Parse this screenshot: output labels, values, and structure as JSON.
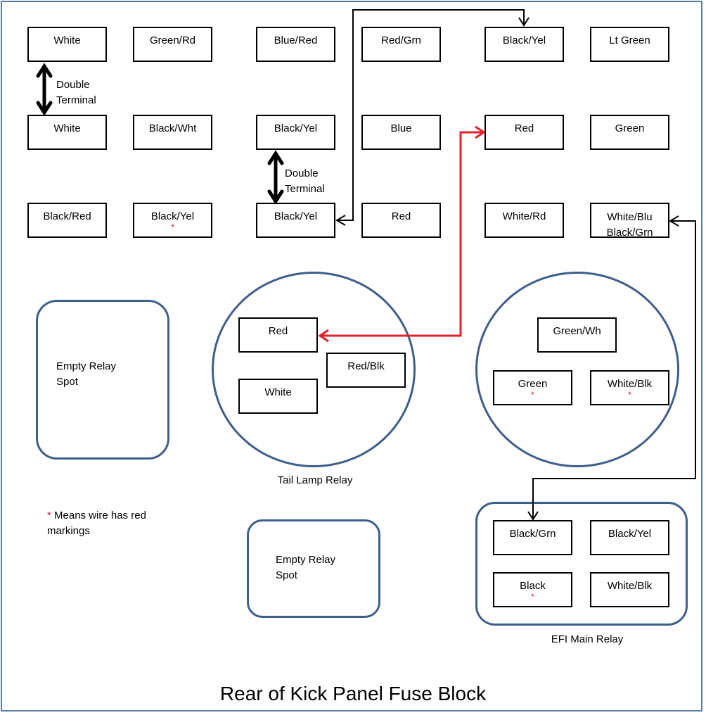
{
  "title": "Rear of Kick Panel Fuse Block",
  "legend": {
    "star": "*",
    "text": "Means wire has red markings"
  },
  "fuse_rows": [
    [
      "White",
      "Green/Rd",
      "Blue/Red",
      "Red/Grn",
      "Black/Yel",
      "Lt Green"
    ],
    [
      "White",
      "Black/Wht",
      "Black/Yel",
      "Blue",
      "Red",
      "Green"
    ],
    [
      "Black/Red",
      "Black/Yel",
      "Black/Yel",
      "Red",
      "White/Rd",
      "White/Blu Black/Grn"
    ]
  ],
  "red_marked": {
    "row3_col2": true
  },
  "double_terminal_label": "Double Terminal",
  "empty_relay_label": "Empty Relay Spot",
  "tail_lamp_relay": {
    "label": "Tail Lamp Relay",
    "pins": [
      "Red",
      "Red/Blk",
      "White"
    ]
  },
  "unnamed_relay": {
    "pins": [
      {
        "wire": "Green/Wh",
        "red_marking": false
      },
      {
        "wire": "Green",
        "red_marking": true
      },
      {
        "wire": "White/Blk",
        "red_marking": true
      }
    ]
  },
  "efi_main_relay": {
    "label": "EFI Main Relay",
    "pins": [
      {
        "wire": "Black/Grn",
        "red_marking": false
      },
      {
        "wire": "Black/Yel",
        "red_marking": false
      },
      {
        "wire": "Black",
        "red_marking": true
      },
      {
        "wire": "White/Blk",
        "red_marking": false
      }
    ]
  },
  "colors": {
    "relay_outline": "#3e5f8a",
    "red_wire": "#e0202a",
    "frame": "#5a7ba3"
  }
}
